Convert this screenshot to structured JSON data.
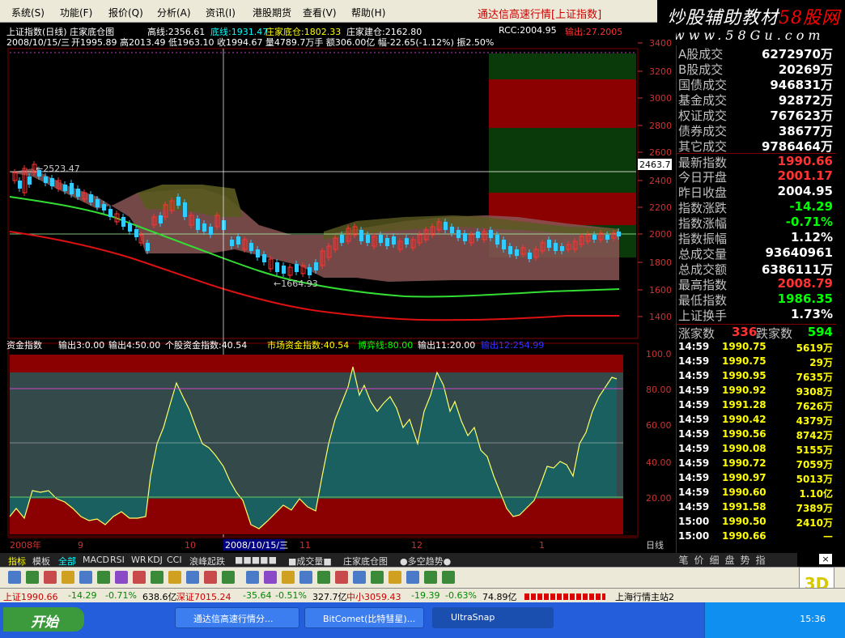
{
  "menu": [
    "系统(S)",
    "功能(F)",
    "报价(Q)",
    "分析(A)",
    "资讯(I)",
    "港股期货",
    "查看(V)",
    "帮助(H)"
  ],
  "app_title": "通达信高速行情",
  "app_title_bracket": "[上证指数]",
  "brand": {
    "line1": "炒股辅助教材",
    "line1_red": "58股网",
    "line2": "www.58Gu.com"
  },
  "chart_header": {
    "line1_a": "上证指数(日线) 庄家底仓图",
    "line1_b": "高线:2356.61",
    "line1_c": "底线:1931.47",
    "line1_d": "庄家底仓:1802.33",
    "line1_e": "庄家建仓:2162.80",
    "line2_date": "2008/10/15/三",
    "line2_rest": "开1995.89 高2013.49 低1963.10 收1994.67 量4789.7万手 额306.00亿 幅-22.65(-1.12%) 振2.50%",
    "rcc": "RCC:2004.95",
    "out": "输出:27.2005"
  },
  "sub_header": {
    "a": "资金指数",
    "b": "输出3:0.00",
    "c": "输出4:50.00",
    "d": "个股资金指数:40.54",
    "e": "市场资金指数:40.54",
    "f": "博弈线:80.00",
    "g": "输出11:20.00",
    "h": "输出12:254.99"
  },
  "annotations": {
    "high": "←2523.47",
    "low": "←1664.93"
  },
  "price_axis": [
    "3400",
    "3200",
    "3000",
    "2800",
    "2600",
    "2400",
    "2200",
    "2000",
    "1800",
    "1600",
    "1400"
  ],
  "current_tag": "2463.7",
  "sub_axis": [
    "100.0",
    "80.00",
    "60.00",
    "40.00",
    "20.00"
  ],
  "time_axis": [
    "2008年",
    "9",
    "10",
    "2008/10/15/三",
    "11",
    "12",
    "1",
    "日线"
  ],
  "right_panel": [
    {
      "l": "A股成交",
      "v": "6272970万"
    },
    {
      "l": "B股成交",
      "v": "20269万"
    },
    {
      "l": "国债成交",
      "v": "946831万"
    },
    {
      "l": "基金成交",
      "v": "92872万"
    },
    {
      "l": "权证成交",
      "v": "767623万"
    },
    {
      "l": "债券成交",
      "v": "38677万"
    },
    {
      "l": "其它成交",
      "v": "9786464万"
    },
    {
      "l": "最新指数",
      "v": "1990.66"
    },
    {
      "l": "今日开盘",
      "v": "2001.17"
    },
    {
      "l": "昨日收盘",
      "v": "2004.95"
    },
    {
      "l": "指数涨跌",
      "v": "-14.29"
    },
    {
      "l": "指数涨幅",
      "v": "-0.71%"
    },
    {
      "l": "指数振幅",
      "v": "1.12%"
    },
    {
      "l": "总成交量",
      "v": "93640961"
    },
    {
      "l": "总成交额",
      "v": "6386111万"
    },
    {
      "l": "最高指数",
      "v": "2008.79"
    },
    {
      "l": "最低指数",
      "v": "1986.35"
    },
    {
      "l": "上证换手",
      "v": "1.73%"
    }
  ],
  "updown": {
    "up_label": "涨家数",
    "up": "336",
    "down_label": "跌家数",
    "down": "594"
  },
  "ticks": [
    {
      "t": "14:59",
      "p": "1990.75",
      "q": "5619万"
    },
    {
      "t": "14:59",
      "p": "1990.75",
      "q": "29万"
    },
    {
      "t": "14:59",
      "p": "1990.95",
      "q": "7635万"
    },
    {
      "t": "14:59",
      "p": "1990.92",
      "q": "9308万"
    },
    {
      "t": "14:59",
      "p": "1991.28",
      "q": "7626万"
    },
    {
      "t": "14:59",
      "p": "1990.42",
      "q": "4379万"
    },
    {
      "t": "14:59",
      "p": "1990.56",
      "q": "8742万"
    },
    {
      "t": "14:59",
      "p": "1990.08",
      "q": "5155万"
    },
    {
      "t": "14:59",
      "p": "1990.72",
      "q": "7059万"
    },
    {
      "t": "14:59",
      "p": "1990.97",
      "q": "5013万"
    },
    {
      "t": "14:59",
      "p": "1990.60",
      "q": "1.10亿"
    },
    {
      "t": "14:59",
      "p": "1991.58",
      "q": "7389万"
    },
    {
      "t": "15:00",
      "p": "1990.50",
      "q": "2410万"
    },
    {
      "t": "15:00",
      "p": "1990.66",
      "q": "—"
    }
  ],
  "rtabs": [
    "笔",
    "价",
    "细",
    "盘",
    "势",
    "指"
  ],
  "close_x": "×",
  "bottom_tabs": [
    "指标",
    "模板",
    "全部",
    "MACD",
    "RSI",
    "WR",
    "KDJ",
    "CCI",
    "浪峰起跌",
    "■■■■■",
    "■成交量■",
    "庄家底仓图",
    "●多空趋势●"
  ],
  "status": {
    "sh": "上证1990.66",
    "sh_chg": "-14.29",
    "sh_pct": "-0.71%",
    "sh_amt": "638.6亿",
    "sz": "深证7015.24",
    "sz_chg": "-35.64",
    "sz_pct": "-0.51%",
    "sz_amt": "327.7亿",
    "zx": "中小3059.43",
    "zx_chg": "-19.39",
    "zx_pct": "-0.63%",
    "zx_amt": "74.89亿",
    "server": "上海行情主站2"
  },
  "taskbar": {
    "start": "开始",
    "t1": "通达信高速行情分...",
    "t2": "BitComet(比特彗星)...",
    "t3": "UltraSnap",
    "clock": "15:36"
  },
  "logo3d": "3D",
  "colors": {
    "up": "#ff3333",
    "down": "#00ffff",
    "pos": "#00ff00",
    "yellow": "#ffff00",
    "band": "#7a4a4a"
  }
}
